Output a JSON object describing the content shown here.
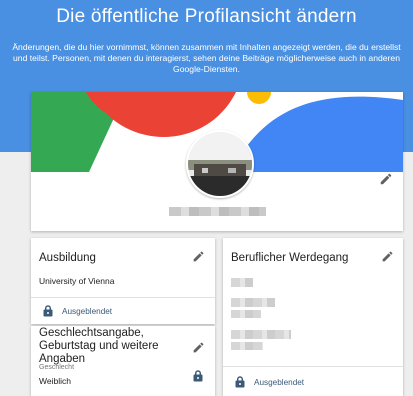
{
  "header": {
    "title": "Die öffentliche Profilansicht ändern",
    "description": "Änderungen, die du hier vornimmst, können zusammen mit Inhalten angezeigt werden, die du erstellst und teilst. Personen, mit denen du interagierst, sehen deine Beiträge möglicherweise auch in anderen Google-Diensten."
  },
  "education": {
    "title": "Ausbildung",
    "value": "University of Vienna",
    "visibility": "Ausgeblendet"
  },
  "career": {
    "title": "Beruflicher Werdegang",
    "visibility": "Ausgeblendet"
  },
  "gender": {
    "title": "Geschlechtsangabe, Geburtstag und weitere Angaben",
    "field_label": "Geschlecht",
    "field_value": "Weiblich"
  },
  "colors": {
    "header_bg": "#4a90e2",
    "google_red": "#ea4335",
    "google_green": "#34a853",
    "google_blue": "#4285f4",
    "google_yellow": "#fbbc05",
    "icon_grey": "#616161",
    "lock_color": "#3a5a78"
  },
  "icons": [
    "pencil-icon",
    "lock-icon"
  ]
}
